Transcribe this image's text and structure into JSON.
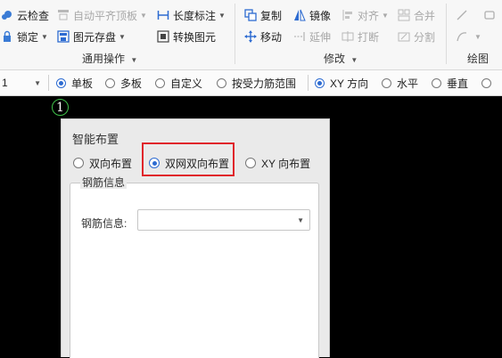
{
  "ribbon": {
    "items": {
      "cloud_check": "云检查",
      "auto_align_top": "自动平齐顶板",
      "length_dim": "长度标注",
      "copy": "复制",
      "mirror": "镜像",
      "align": "对齐",
      "merge": "合并",
      "lock": "锁定",
      "element_save": "图元存盘",
      "convert_element": "转换图元",
      "move": "移动",
      "extend": "延伸",
      "break": "打断",
      "split": "分割"
    },
    "groups": {
      "common": "通用操作",
      "modify": "修改",
      "draw": "绘图"
    }
  },
  "optionbar": {
    "left_value": "1",
    "options": {
      "single": "单板",
      "multi": "多板",
      "custom": "自定义",
      "by_stress": "按受力筋范围",
      "xy_dir": "XY 方向",
      "horizontal": "水平",
      "vertical": "垂直"
    },
    "selected_left": "single",
    "selected_right": "xy_dir"
  },
  "marker": {
    "label": "1"
  },
  "panel": {
    "title": "智能布置",
    "options": {
      "bidir": "双向布置",
      "dual_net": "双网双向布置",
      "xy_dir": "XY 向布置"
    },
    "selected": "dual_net",
    "rebar_group": {
      "title": "钢筋信息",
      "field_label": "钢筋信息:",
      "field_value": ""
    }
  },
  "colors": {
    "highlight": "#e0262b",
    "radio_selected": "#2d6bd1",
    "marker_ring": "#3fc24a",
    "canvas": "#000000"
  },
  "icons": [
    "cloud-check-icon",
    "auto-align-icon",
    "length-dim-icon",
    "copy-icon",
    "mirror-icon",
    "align-icon",
    "merge-icon",
    "line-icon",
    "rect-icon",
    "lock-icon",
    "element-save-icon",
    "convert-icon",
    "move-icon",
    "extend-icon",
    "break-icon",
    "split-icon",
    "arc-icon"
  ]
}
